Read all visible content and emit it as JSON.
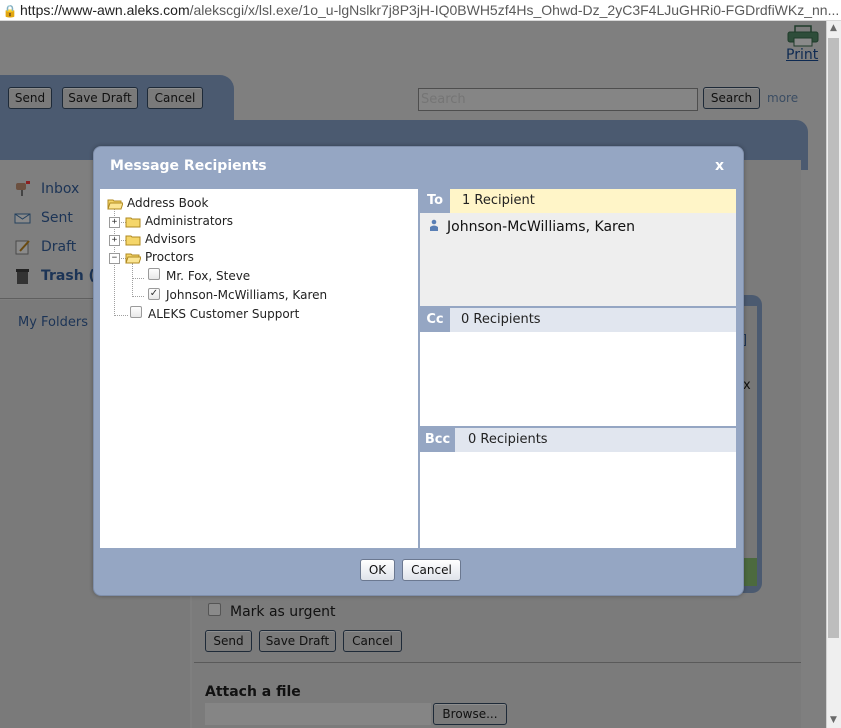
{
  "browser": {
    "url_host": "https://www-awn.aleks.com",
    "url_path": "/alekscgi/x/lsl.exe/1o_u-lgNslkr7j8P3jH-IQ0BWH5zf4Hs_Ohwd-Dz_2yC3F4LJuGHRi0-FGDrdfiWKz_nn..."
  },
  "page": {
    "print_label": "Print",
    "toolbar": {
      "send_label": "Send",
      "save_draft_label": "Save Draft",
      "cancel_label": "Cancel"
    },
    "search": {
      "placeholder": "Search",
      "button_label": "Search",
      "more_label": "more"
    },
    "nav": {
      "inbox": "Inbox",
      "sent": "Sent",
      "draft": "Draft",
      "trash": "Trash (",
      "my_folders": "My Folders"
    },
    "stub_texts": {
      "bracket": "]",
      "x": "x"
    },
    "compose": {
      "urgent_label": "Mark as urgent",
      "send_label": "Send",
      "save_draft_label": "Save Draft",
      "cancel_label": "Cancel",
      "attach_label": "Attach a file",
      "browse_label": "Browse..."
    }
  },
  "modal": {
    "title": "Message Recipients",
    "close_label": "x",
    "tree": {
      "root": "Address Book",
      "administrators": "Administrators",
      "advisors": "Advisors",
      "proctors": "Proctors",
      "proctor_1": "Mr. Fox, Steve",
      "proctor_2": "Johnson-McWilliams, Karen",
      "support": "ALEKS Customer Support"
    },
    "to": {
      "tag": "To",
      "count": "1 Recipient",
      "recipients": [
        "Johnson-McWilliams, Karen"
      ]
    },
    "cc": {
      "tag": "Cc",
      "count": "0 Recipients"
    },
    "bcc": {
      "tag": "Bcc",
      "count": "0 Recipients"
    },
    "ok_label": "OK",
    "cancel_label": "Cancel"
  },
  "colors": {
    "modal_frame": "#95a6c3",
    "to_highlight": "#fff5c8",
    "section_header": "#e1e6ef",
    "overlay_dim": "#7f7f7f"
  }
}
